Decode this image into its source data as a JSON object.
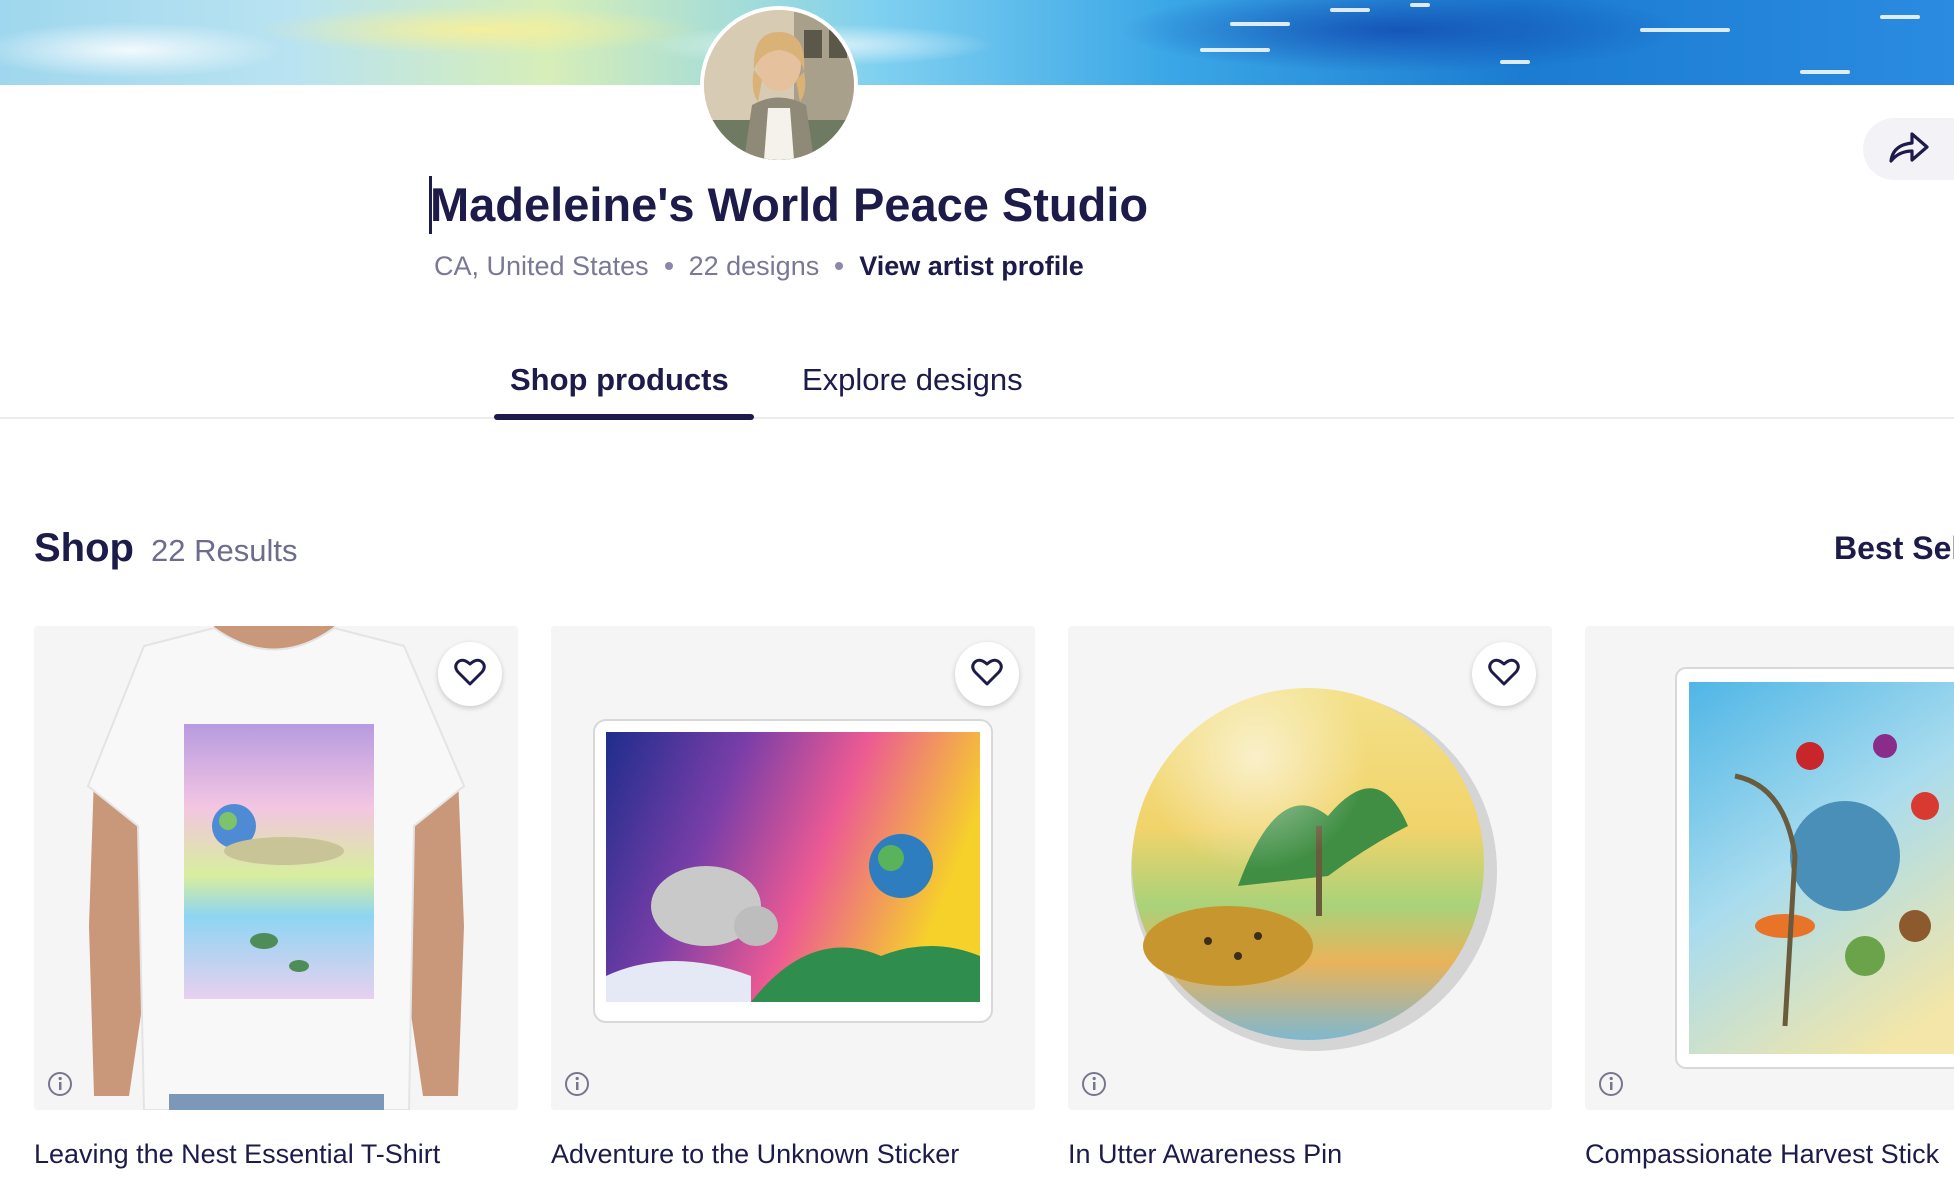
{
  "shop": {
    "name": "Madeleine's World Peace Studio",
    "location": "CA, United States",
    "designs_count": "22 designs",
    "artist_link": "View artist profile"
  },
  "share": {
    "icon": "share-arrow-icon"
  },
  "tabs": [
    {
      "label": "Shop products",
      "active": true
    },
    {
      "label": "Explore designs",
      "active": false
    }
  ],
  "results": {
    "heading": "Shop",
    "count": "22 Results",
    "sort_label": "Best Sel"
  },
  "products": [
    {
      "title": "Leaving the Nest Essential T-Shirt",
      "kind": "t-shirt"
    },
    {
      "title": "Adventure to the Unknown Sticker",
      "kind": "sticker"
    },
    {
      "title": "In Utter Awareness Pin",
      "kind": "pin"
    },
    {
      "title": "Compassionate Harvest Stick",
      "kind": "sticker"
    }
  ],
  "colors": {
    "ink": "#1c1b4a",
    "muted": "#7a7896",
    "card_bg": "#f5f5f6"
  }
}
